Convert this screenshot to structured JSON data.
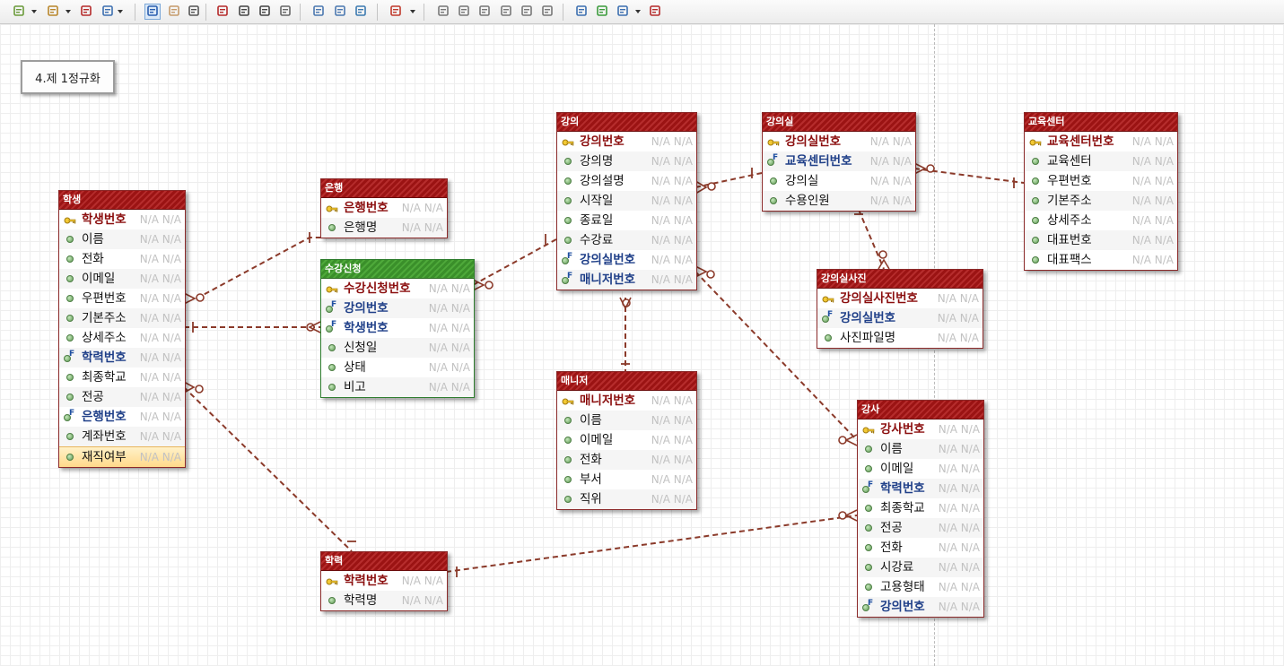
{
  "toolbar": {
    "buttons": [
      "layout-icon",
      "schema-icon",
      "table-icon",
      "document-icon",
      "pointer-icon",
      "hand-icon",
      "zoom-icon",
      "new-table-icon",
      "nonidentifying-relation-icon",
      "identifying-relation-icon",
      "memo-icon",
      "print-preview-icon",
      "print-icon",
      "export-image-icon",
      "color-icon",
      "align-left-icon",
      "align-center-icon",
      "align-right-icon",
      "align-top-icon",
      "align-middle-icon",
      "align-bottom-icon",
      "properties-icon",
      "validate-icon",
      "refresh-icon",
      "help-icon"
    ]
  },
  "memo": {
    "text": "4.제 1정규화"
  },
  "colors": {
    "header_red": "#9b1313",
    "header_green": "#3a8f2a",
    "relation": "#8b3a2a",
    "null_text": "#c2c2c2"
  },
  "entities": {
    "student": {
      "title": "학생",
      "rows": [
        {
          "name": "학생번호",
          "kind": "pk",
          "meta": "N/A N/A"
        },
        {
          "name": "이름",
          "kind": "col",
          "meta": "N/A N/A"
        },
        {
          "name": "전화",
          "kind": "col",
          "meta": "N/A N/A"
        },
        {
          "name": "이메일",
          "kind": "col",
          "meta": "N/A N/A"
        },
        {
          "name": "우편번호",
          "kind": "col",
          "meta": "N/A N/A"
        },
        {
          "name": "기본주소",
          "kind": "col",
          "meta": "N/A N/A"
        },
        {
          "name": "상세주소",
          "kind": "col",
          "meta": "N/A N/A"
        },
        {
          "name": "학력번호",
          "kind": "fk",
          "meta": "N/A N/A"
        },
        {
          "name": "최종학교",
          "kind": "col",
          "meta": "N/A N/A"
        },
        {
          "name": "전공",
          "kind": "col",
          "meta": "N/A N/A"
        },
        {
          "name": "은행번호",
          "kind": "fk",
          "meta": "N/A N/A"
        },
        {
          "name": "계좌번호",
          "kind": "col",
          "meta": "N/A N/A"
        },
        {
          "name": "재직여부",
          "kind": "col",
          "meta": "N/A N/A",
          "selected": true
        }
      ]
    },
    "bank": {
      "title": "은행",
      "rows": [
        {
          "name": "은행번호",
          "kind": "pk",
          "meta": "N/A N/A"
        },
        {
          "name": "은행명",
          "kind": "col",
          "meta": "N/A N/A"
        }
      ]
    },
    "enrollment": {
      "title": "수강신청",
      "rows": [
        {
          "name": "수강신청번호",
          "kind": "pk",
          "meta": "N/A N/A"
        },
        {
          "name": "강의번호",
          "kind": "fk",
          "meta": "N/A N/A"
        },
        {
          "name": "학생번호",
          "kind": "fk",
          "meta": "N/A N/A"
        },
        {
          "name": "신청일",
          "kind": "col",
          "meta": "N/A N/A"
        },
        {
          "name": "상태",
          "kind": "col",
          "meta": "N/A N/A"
        },
        {
          "name": "비고",
          "kind": "col",
          "meta": "N/A N/A"
        }
      ]
    },
    "lecture": {
      "title": "강의",
      "rows": [
        {
          "name": "강의번호",
          "kind": "pk",
          "meta": "N/A N/A"
        },
        {
          "name": "강의명",
          "kind": "col",
          "meta": "N/A N/A"
        },
        {
          "name": "강의설명",
          "kind": "col",
          "meta": "N/A N/A"
        },
        {
          "name": "시작일",
          "kind": "col",
          "meta": "N/A N/A"
        },
        {
          "name": "종료일",
          "kind": "col",
          "meta": "N/A N/A"
        },
        {
          "name": "수강료",
          "kind": "col",
          "meta": "N/A N/A"
        },
        {
          "name": "강의실번호",
          "kind": "fk",
          "meta": "N/A N/A"
        },
        {
          "name": "매니저번호",
          "kind": "fk",
          "meta": "N/A N/A"
        }
      ]
    },
    "manager": {
      "title": "매니저",
      "rows": [
        {
          "name": "매니저번호",
          "kind": "pk",
          "meta": "N/A N/A"
        },
        {
          "name": "이름",
          "kind": "col",
          "meta": "N/A N/A"
        },
        {
          "name": "이메일",
          "kind": "col",
          "meta": "N/A N/A"
        },
        {
          "name": "전화",
          "kind": "col",
          "meta": "N/A N/A"
        },
        {
          "name": "부서",
          "kind": "col",
          "meta": "N/A N/A"
        },
        {
          "name": "직위",
          "kind": "col",
          "meta": "N/A N/A"
        }
      ]
    },
    "classroom": {
      "title": "강의실",
      "rows": [
        {
          "name": "강의실번호",
          "kind": "pk",
          "meta": "N/A N/A"
        },
        {
          "name": "교육센터번호",
          "kind": "fk",
          "meta": "N/A N/A"
        },
        {
          "name": "강의실",
          "kind": "col",
          "meta": "N/A N/A"
        },
        {
          "name": "수용인원",
          "kind": "col",
          "meta": "N/A N/A"
        }
      ]
    },
    "center": {
      "title": "교육센터",
      "rows": [
        {
          "name": "교육센터번호",
          "kind": "pk",
          "meta": "N/A N/A"
        },
        {
          "name": "교육센터",
          "kind": "col",
          "meta": "N/A N/A"
        },
        {
          "name": "우편번호",
          "kind": "col",
          "meta": "N/A N/A"
        },
        {
          "name": "기본주소",
          "kind": "col",
          "meta": "N/A N/A"
        },
        {
          "name": "상세주소",
          "kind": "col",
          "meta": "N/A N/A"
        },
        {
          "name": "대표번호",
          "kind": "col",
          "meta": "N/A N/A"
        },
        {
          "name": "대표팩스",
          "kind": "col",
          "meta": "N/A N/A"
        }
      ]
    },
    "room_photo": {
      "title": "강의실사진",
      "rows": [
        {
          "name": "강의실사진번호",
          "kind": "pk",
          "meta": "N/A N/A"
        },
        {
          "name": "강의실번호",
          "kind": "fk",
          "meta": "N/A N/A"
        },
        {
          "name": "사진파일명",
          "kind": "col",
          "meta": "N/A N/A"
        }
      ]
    },
    "instructor": {
      "title": "강사",
      "rows": [
        {
          "name": "강사번호",
          "kind": "pk",
          "meta": "N/A N/A"
        },
        {
          "name": "이름",
          "kind": "col",
          "meta": "N/A N/A"
        },
        {
          "name": "이메일",
          "kind": "col",
          "meta": "N/A N/A"
        },
        {
          "name": "학력번호",
          "kind": "fk",
          "meta": "N/A N/A"
        },
        {
          "name": "최종학교",
          "kind": "col",
          "meta": "N/A N/A"
        },
        {
          "name": "전공",
          "kind": "col",
          "meta": "N/A N/A"
        },
        {
          "name": "전화",
          "kind": "col",
          "meta": "N/A N/A"
        },
        {
          "name": "시강료",
          "kind": "col",
          "meta": "N/A N/A"
        },
        {
          "name": "고용형태",
          "kind": "col",
          "meta": "N/A N/A"
        },
        {
          "name": "강의번호",
          "kind": "fk",
          "meta": "N/A N/A"
        }
      ]
    },
    "education": {
      "title": "학력",
      "rows": [
        {
          "name": "학력번호",
          "kind": "pk",
          "meta": "N/A N/A"
        },
        {
          "name": "학력명",
          "kind": "col",
          "meta": "N/A N/A"
        }
      ]
    }
  },
  "relationships": [
    {
      "from": "bank",
      "to": "student",
      "cardinality": "one-to-zero-or-many"
    },
    {
      "from": "student",
      "to": "enrollment",
      "cardinality": "one-to-zero-or-many"
    },
    {
      "from": "lecture",
      "to": "enrollment",
      "cardinality": "one-to-zero-or-many"
    },
    {
      "from": "classroom",
      "to": "lecture",
      "cardinality": "one-to-zero-or-many"
    },
    {
      "from": "center",
      "to": "classroom",
      "cardinality": "one-to-zero-or-many"
    },
    {
      "from": "classroom",
      "to": "room_photo",
      "cardinality": "one-to-zero-or-many"
    },
    {
      "from": "manager",
      "to": "lecture",
      "cardinality": "one-to-zero-or-many"
    },
    {
      "from": "education",
      "to": "student",
      "cardinality": "one-to-zero-or-many"
    },
    {
      "from": "lecture",
      "to": "instructor",
      "cardinality": "one-to-zero-or-many"
    },
    {
      "from": "education",
      "to": "instructor",
      "cardinality": "one-to-zero-or-many"
    }
  ]
}
